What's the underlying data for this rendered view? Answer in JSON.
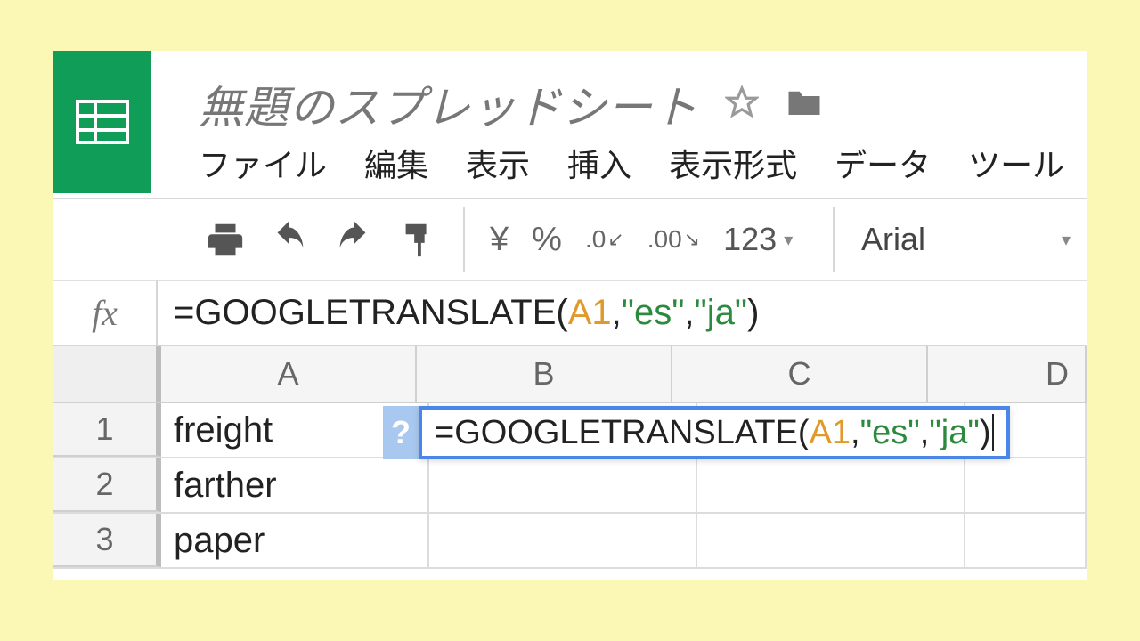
{
  "header": {
    "doc_title": "無題のスプレッドシート",
    "menus": [
      "ファイル",
      "編集",
      "表示",
      "挿入",
      "表示形式",
      "データ",
      "ツール"
    ]
  },
  "toolbar": {
    "currency": "¥",
    "percent": "%",
    "dec_decrease": ".0",
    "dec_increase": ".00",
    "num_format": "123",
    "font_name": "Arial"
  },
  "formula_bar": {
    "fx_label": "fx",
    "tokens": {
      "eqfn": "=GOOGLETRANSLATE(",
      "ref": "A1",
      "comma1": ",",
      "str1": "\"es\"",
      "comma2": ",",
      "str2": "\"ja\"",
      "close": ")"
    }
  },
  "editing_cell": {
    "help_label": "?",
    "tokens": {
      "eqfn": "=GOOGLETRANSLATE(",
      "ref": "A1",
      "comma1": ",",
      "str1": "\"es\"",
      "comma2": ",",
      "str2": "\"ja\"",
      "close": ")"
    }
  },
  "grid": {
    "columns": [
      "A",
      "B",
      "C",
      "D"
    ],
    "rows": [
      {
        "n": "1",
        "A": "freight",
        "B": "",
        "C": "",
        "D": ""
      },
      {
        "n": "2",
        "A": "farther",
        "B": "",
        "C": "",
        "D": ""
      },
      {
        "n": "3",
        "A": "paper",
        "B": "",
        "C": "",
        "D": ""
      }
    ]
  }
}
